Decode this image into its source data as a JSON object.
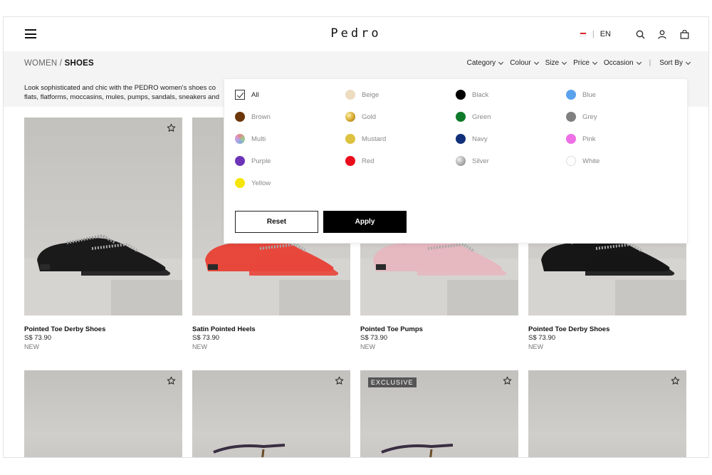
{
  "header": {
    "brand": "Pedro",
    "language": "EN",
    "icons": [
      "menu-icon",
      "flag-icon",
      "search-icon",
      "account-icon",
      "bag-icon"
    ]
  },
  "breadcrumb": {
    "parent": "WOMEN",
    "separator": "/",
    "current": "SHOES"
  },
  "description": {
    "line1": "Look sophisticated and chic with the PEDRO women's shoes co",
    "line2": "flats, flatforms, moccasins, mules, pumps, sandals, sneakers and"
  },
  "filters": {
    "items": [
      "Category",
      "Colour",
      "Size",
      "Price",
      "Occasion"
    ],
    "sort": "Sort By"
  },
  "colour_filter": {
    "options": [
      {
        "label": "All",
        "checked": true
      },
      {
        "label": "Beige",
        "color": "#ecdcc0"
      },
      {
        "label": "Black",
        "color": "#000000"
      },
      {
        "label": "Blue",
        "color": "#5aa2ee"
      },
      {
        "label": "Brown",
        "color": "#6b3609"
      },
      {
        "label": "Gold",
        "color": "#d4a72c"
      },
      {
        "label": "Green",
        "color": "#0f7a2a"
      },
      {
        "label": "Grey",
        "color": "#808080"
      },
      {
        "label": "Multi",
        "color": "multi"
      },
      {
        "label": "Mustard",
        "color": "#dcc23e"
      },
      {
        "label": "Navy",
        "color": "#12307a"
      },
      {
        "label": "Pink",
        "color": "#ee6fe6"
      },
      {
        "label": "Purple",
        "color": "#6d34b8"
      },
      {
        "label": "Red",
        "color": "#ea0c1c"
      },
      {
        "label": "Silver",
        "color": "#b0b0b0"
      },
      {
        "label": "White",
        "color": "#ffffff"
      },
      {
        "label": "Yellow",
        "color": "#f5e60a"
      }
    ],
    "reset_label": "Reset",
    "apply_label": "Apply"
  },
  "products": [
    {
      "name": "Pointed Toe Derby Shoes",
      "price": "S$ 73.90",
      "tag": "NEW",
      "shoe_color": "#1a1a1a"
    },
    {
      "name": "Satin Pointed Heels",
      "price": "S$ 73.90",
      "tag": "NEW",
      "shoe_color": "#e8473c"
    },
    {
      "name": "Pointed Toe Pumps",
      "price": "S$ 73.90",
      "tag": "NEW",
      "shoe_color": "#e6b8c0"
    },
    {
      "name": "Pointed Toe Derby Shoes",
      "price": "S$ 73.90",
      "tag": "NEW",
      "shoe_color": "#161616"
    }
  ],
  "row2": [
    {
      "badge": ""
    },
    {
      "badge": ""
    },
    {
      "badge": "EXCLUSIVE"
    },
    {
      "badge": ""
    }
  ]
}
